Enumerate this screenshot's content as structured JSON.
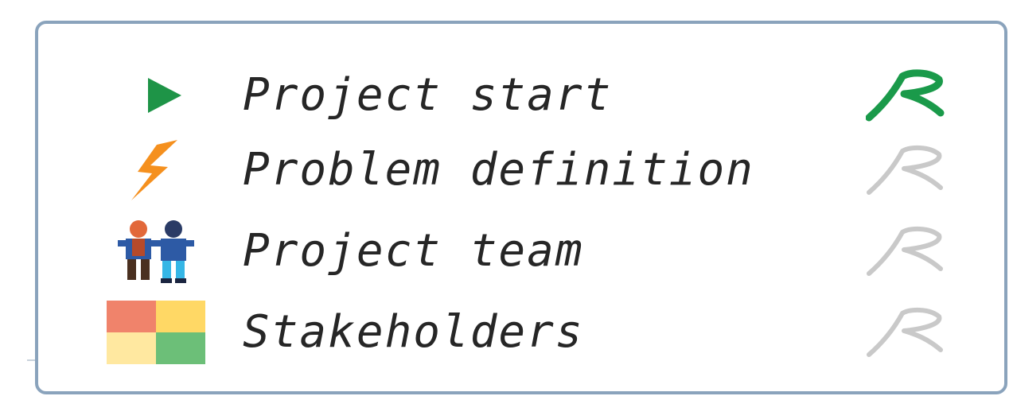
{
  "steps": [
    {
      "label": "Project start",
      "icon": "play-icon",
      "status": "active",
      "status_color": "#1a9a4a"
    },
    {
      "label": "Problem definition",
      "icon": "lightning-icon",
      "status": "inactive",
      "status_color": "#c9c9c9"
    },
    {
      "label": "Project team",
      "icon": "team-icon",
      "status": "inactive",
      "status_color": "#c9c9c9"
    },
    {
      "label": "Stakeholders",
      "icon": "stakeholder-grid-icon",
      "status": "inactive",
      "status_color": "#c9c9c9"
    }
  ],
  "colors": {
    "border": "#8aa3bc",
    "play": "#1e9447",
    "lightning": "#f5901e",
    "grid": [
      "#f0836b",
      "#ffd865",
      "#ffe8a0",
      "#6cbf78"
    ]
  }
}
